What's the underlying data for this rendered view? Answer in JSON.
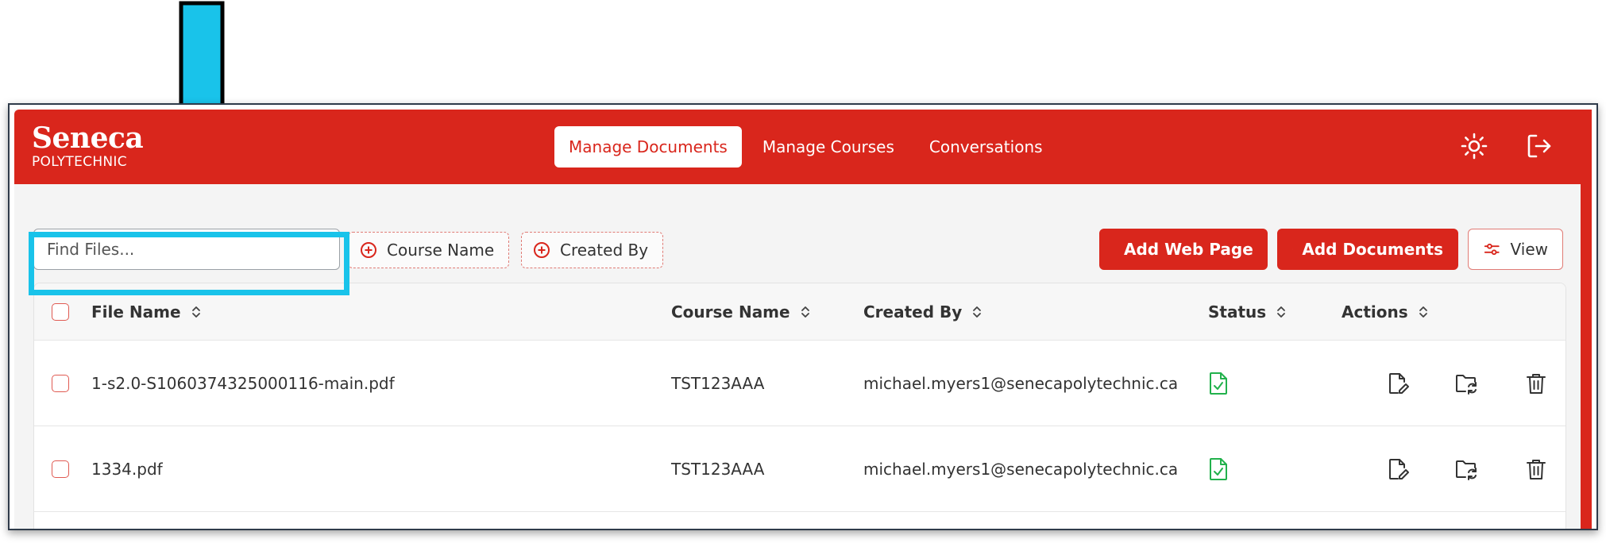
{
  "brand": {
    "name": "Seneca",
    "subtitle": "POLYTECHNIC"
  },
  "nav": {
    "tabs": [
      {
        "label": "Manage Documents",
        "active": true
      },
      {
        "label": "Manage Courses",
        "active": false
      },
      {
        "label": "Conversations",
        "active": false
      }
    ]
  },
  "header_icons": [
    "sun-icon",
    "logout-icon"
  ],
  "toolbar": {
    "search_placeholder": "Find Files...",
    "filters": {
      "course_name": "Course Name",
      "created_by": "Created By"
    },
    "add_web_page": "Add Web Page",
    "add_documents": "Add Documents",
    "view": "View"
  },
  "table": {
    "columns": [
      "File Name",
      "Course Name",
      "Created By",
      "Status",
      "Actions"
    ],
    "rows": [
      {
        "file_name": "1-s2.0-S1060374325000116-main.pdf",
        "course_name": "TST123AAA",
        "created_by": "michael.myers1@senecapolytechnic.ca",
        "status_icon": "file-check-icon"
      },
      {
        "file_name": "1334.pdf",
        "course_name": "TST123AAA",
        "created_by": "michael.myers1@senecapolytechnic.ca",
        "status_icon": "file-check-icon"
      }
    ],
    "row_actions": [
      "edit-file-icon",
      "move-folder-icon",
      "trash-icon"
    ]
  },
  "colors": {
    "brand_red": "#d9261c",
    "highlight_cyan": "#19c3ea",
    "status_green": "#22b14c"
  }
}
